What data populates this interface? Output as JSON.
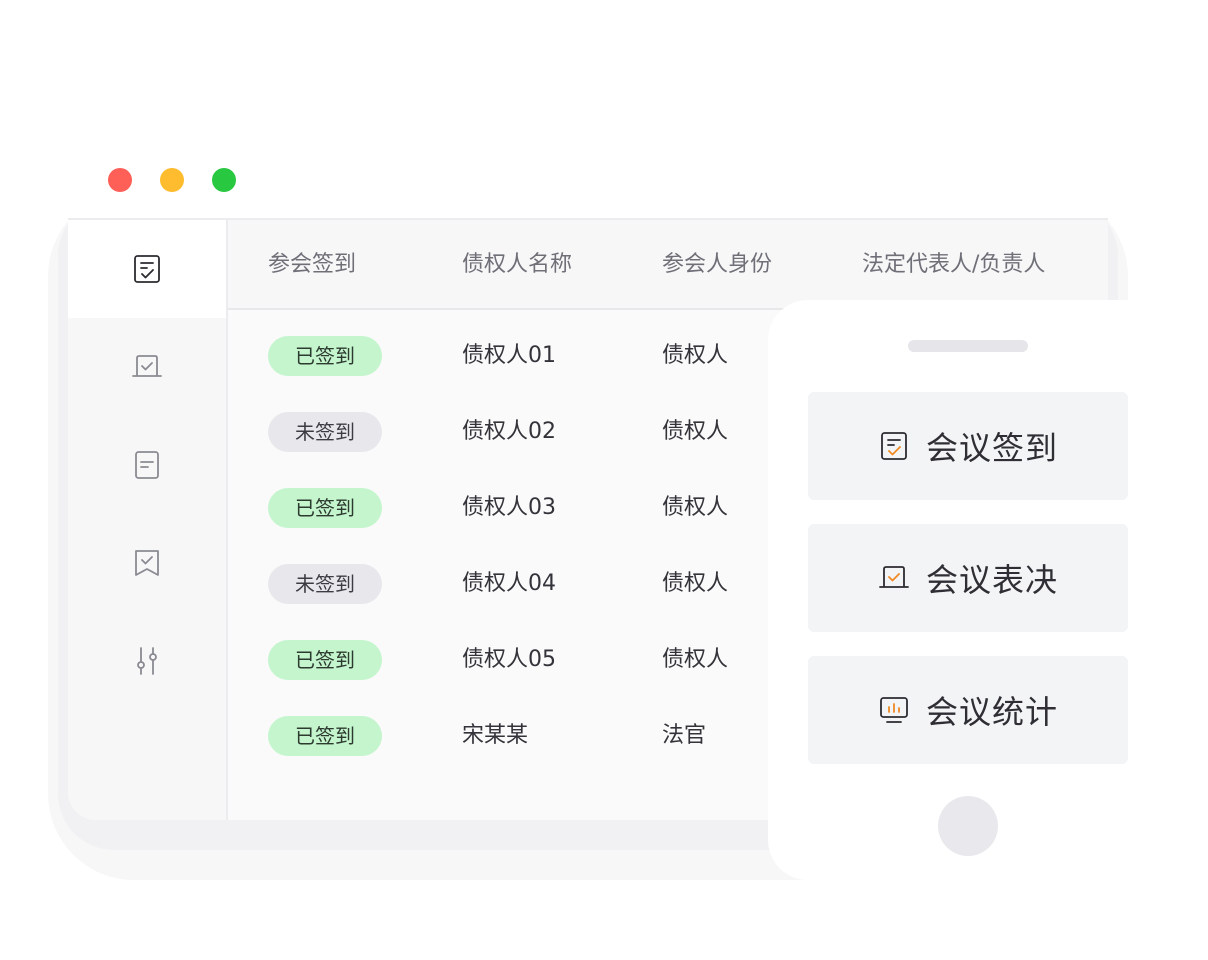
{
  "sidebar": {
    "items": [
      {
        "icon": "checklist-icon",
        "active": true
      },
      {
        "icon": "laptop-check-icon",
        "active": false
      },
      {
        "icon": "document-icon",
        "active": false
      },
      {
        "icon": "ribbon-check-icon",
        "active": false
      },
      {
        "icon": "sliders-icon",
        "active": false
      }
    ]
  },
  "table": {
    "headers": [
      "参会签到",
      "债权人名称",
      "参会人身份",
      "法定代表人/负责人"
    ],
    "rows": [
      {
        "status": "已签到",
        "signed": true,
        "name": "债权人01",
        "identity": "债权人"
      },
      {
        "status": "未签到",
        "signed": false,
        "name": "债权人02",
        "identity": "债权人"
      },
      {
        "status": "已签到",
        "signed": true,
        "name": "债权人03",
        "identity": "债权人"
      },
      {
        "status": "未签到",
        "signed": false,
        "name": "债权人04",
        "identity": "债权人"
      },
      {
        "status": "已签到",
        "signed": true,
        "name": "债权人05",
        "identity": "债权人"
      },
      {
        "status": "已签到",
        "signed": true,
        "name": "宋某某",
        "identity": "法官"
      }
    ]
  },
  "phone": {
    "cards": [
      {
        "label": "会议签到",
        "icon": "checklist-icon"
      },
      {
        "label": "会议表决",
        "icon": "laptop-check-icon"
      },
      {
        "label": "会议统计",
        "icon": "monitor-chart-icon"
      }
    ]
  },
  "colors": {
    "signed_badge": "#c4f5cd",
    "unsigned_badge": "#e8e8ec",
    "accent_orange": "#f08a24",
    "window_red": "#fe5f57",
    "window_yellow": "#febc2e",
    "window_green": "#28c840"
  }
}
